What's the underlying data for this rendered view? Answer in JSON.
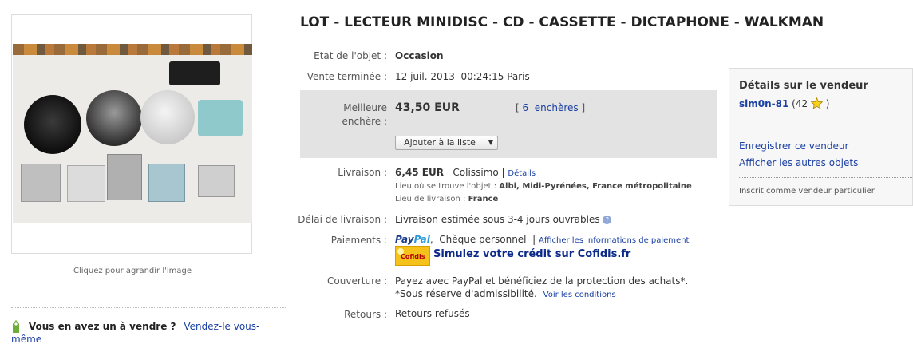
{
  "listing": {
    "title": "LOT - LECTEUR MINIDISC - CD - CASSETTE - DICTAPHONE - WALKMAN",
    "image_caption": "Cliquez pour agrandir l'image",
    "sell_question": "Vous en avez un à vendre ?",
    "sell_link": "Vendez-le vous-même"
  },
  "details": {
    "condition_label": "Etat de l'objet :",
    "condition_value": "Occasion",
    "ended_label": "Vente terminée :",
    "ended_value": "12 juil. 2013  00:24:15 Paris",
    "bid_label_1": "Meilleure",
    "bid_label_2": "enchère :",
    "bid_value": "43,50 EUR",
    "bids_open": "[",
    "bids_count": "6",
    "bids_word": "enchères",
    "bids_close": "]",
    "watch_button": "Ajouter à la liste",
    "shipping_label": "Livraison :",
    "shipping_price": "6,45 EUR",
    "shipping_service": "Colissimo |",
    "shipping_details_link": "Détails",
    "item_location_label": "Lieu où se trouve l'objet :",
    "item_location_value": "Albi, Midi-Pyrénées, France métropolitaine",
    "ship_to_label": "Lieu de livraison :",
    "ship_to_value": "France",
    "delivery_label": "Délai de livraison :",
    "delivery_value": "Livraison estimée sous 3-4 jours ouvrables",
    "payment_label": "Paiements :",
    "paypal_p1": "Pay",
    "paypal_p2": "Pal",
    "payment_other": ",  Chèque personnel  |",
    "payment_info_link": "Afficher les informations de paiement",
    "cofidis_logo": "Cofidis",
    "cofidis_link": "Simulez votre crédit sur Cofidis.fr",
    "coverage_label": "Couverture :",
    "coverage_line1": "Payez avec PayPal et bénéficiez de la protection des achats*.",
    "coverage_line2": "*Sous réserve d'admissibilité.",
    "coverage_link": "Voir les conditions",
    "returns_label": "Retours :",
    "returns_value": "Retours refusés"
  },
  "seller": {
    "heading": "Détails sur le vendeur",
    "username": "sim0n-81",
    "feedback_open": "(42",
    "feedback_close": ")",
    "save_seller": "Enregistrer ce vendeur",
    "other_items": "Afficher les autres objets",
    "seller_type": "Inscrit comme vendeur particulier"
  },
  "icons": {
    "star": "yellow-star-icon",
    "help": "question-icon",
    "tag": "price-tag-icon",
    "dropdown": "chevron-down-icon"
  },
  "colors": {
    "link": "#1a3fa3",
    "bid_box": "#e3e3e3",
    "cofidis": "#f4c21a"
  }
}
